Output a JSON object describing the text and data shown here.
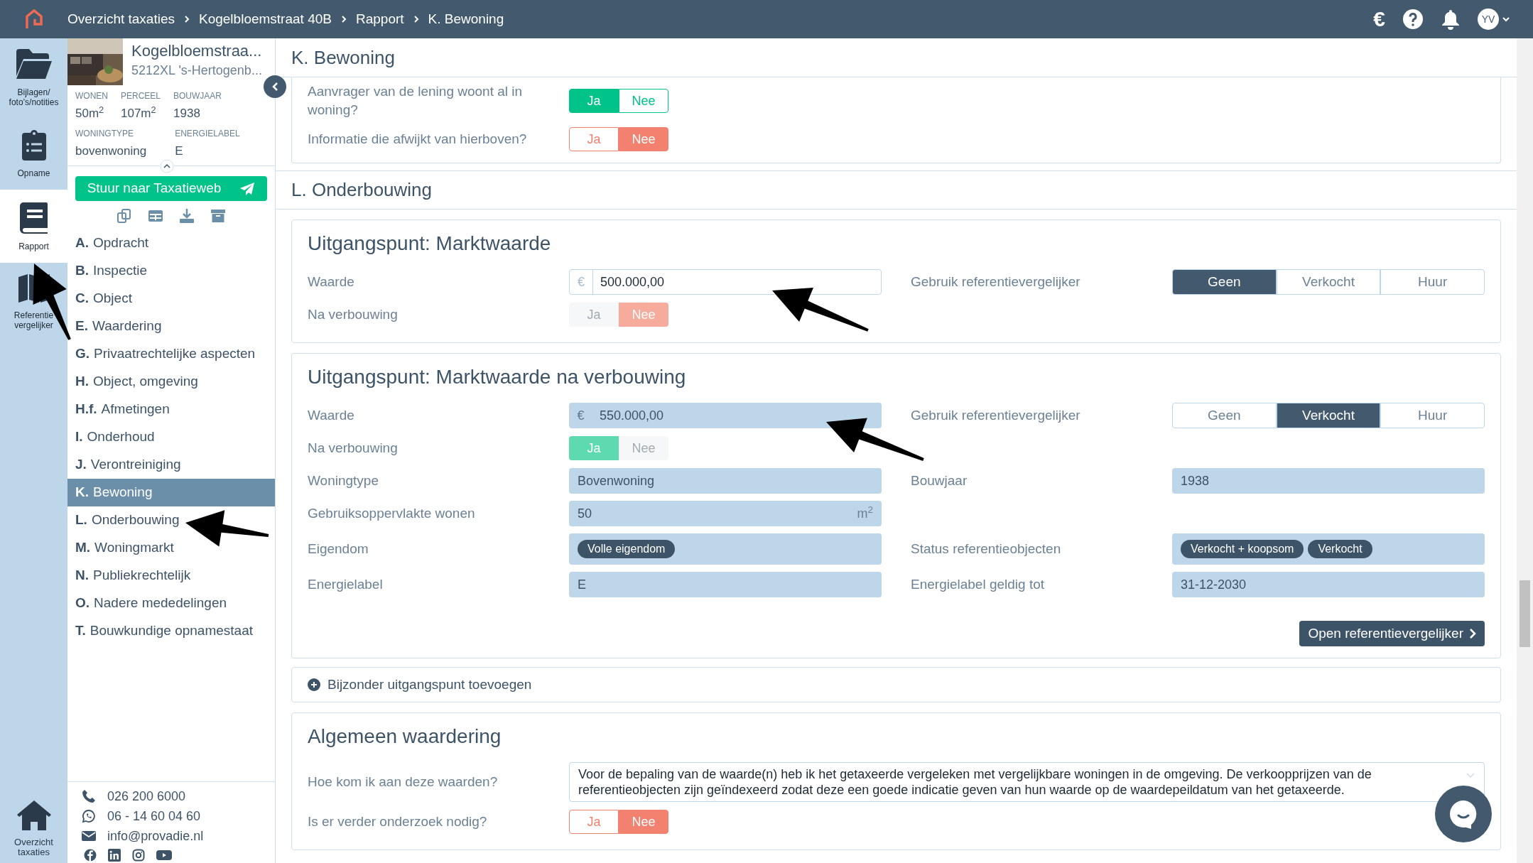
{
  "topbar": {
    "breadcrumbs": [
      "Overzicht taxaties",
      "Kogelbloemstraat 40B",
      "Rapport",
      "K. Bewoning"
    ],
    "currency_symbol": "€",
    "avatar": "YV"
  },
  "rail": [
    {
      "label": "Bijlagen/ foto’s/notities",
      "selected": false
    },
    {
      "label": "Opname",
      "selected": false
    },
    {
      "label": "Rapport",
      "selected": true
    },
    {
      "label": "Referentie vergelijker",
      "selected": false
    }
  ],
  "rail_bottom": {
    "label": "Overzicht taxaties"
  },
  "property": {
    "title": "Kogelbloemstraa...",
    "address": "5212XL 's-Hertogenb...",
    "facts": [
      {
        "label": "WONEN",
        "value": "50m$^{2}$"
      },
      {
        "label": "PERCEEL",
        "value": "107m$^{2}$"
      },
      {
        "label": "BOUWJAAR",
        "value": "1938"
      }
    ],
    "facts2": [
      {
        "label": "WONINGTYPE",
        "value": "bovenwoning"
      },
      {
        "label": "ENERGIELABEL",
        "value": "E"
      }
    ]
  },
  "send_button": "Stuur naar Taxatieweb",
  "nav": [
    {
      "letter": "A.",
      "label": "Opdracht",
      "selected": false
    },
    {
      "letter": "B.",
      "label": "Inspectie",
      "selected": false
    },
    {
      "letter": "C.",
      "label": "Object",
      "selected": false
    },
    {
      "letter": "E.",
      "label": "Waardering",
      "selected": false
    },
    {
      "letter": "G.",
      "label": "Privaatrechtelijke aspecten",
      "selected": false
    },
    {
      "letter": "H.",
      "label": "Object, omgeving",
      "selected": false
    },
    {
      "letter": "H.f.",
      "label": "Afmetingen",
      "selected": false
    },
    {
      "letter": "I.",
      "label": "Onderhoud",
      "selected": false
    },
    {
      "letter": "J.",
      "label": "Verontreiniging",
      "selected": false
    },
    {
      "letter": "K.",
      "label": "Bewoning",
      "selected": true
    },
    {
      "letter": "L.",
      "label": "Onderbouwing",
      "selected": false
    },
    {
      "letter": "M.",
      "label": "Woningmarkt",
      "selected": false
    },
    {
      "letter": "N.",
      "label": "Publiekrechtelijk",
      "selected": false
    },
    {
      "letter": "O.",
      "label": "Nadere mededelingen",
      "selected": false
    },
    {
      "letter": "T.",
      "label": "Bouwkundige opnamestaat",
      "selected": false
    }
  ],
  "contact": [
    {
      "kind": "phone",
      "text": "026 200 6000"
    },
    {
      "kind": "whatsapp",
      "text": "06 - 14 60 04 60"
    },
    {
      "kind": "mail",
      "text": "info@provadie.nl"
    }
  ],
  "sections": [
    {
      "heading": "K. Bewoning",
      "cards": [
        {
          "rows": [
            [
              {
                "kind": "toggle",
                "label": "Aanvrager van de lening woont al in woning?",
                "disabled": false,
                "options": [
                  {
                    "label": "Ja",
                    "selected": true
                  },
                  {
                    "label": "Nee",
                    "selected": false
                  }
                ]
              }
            ],
            [
              {
                "kind": "toggle",
                "label": "Informatie die afwijkt van hierboven?",
                "disabled": false,
                "options": [
                  {
                    "label": "Ja",
                    "selected": false
                  },
                  {
                    "label": "Nee",
                    "selected": true
                  }
                ]
              }
            ]
          ]
        }
      ]
    },
    {
      "heading": "L. Onderbouwing",
      "cards": [
        {
          "title": "Uitgangspunt: Marktwaarde",
          "rows": [
            [
              {
                "kind": "money",
                "label": "Waarde",
                "currency": "€",
                "value": "500.000,00",
                "readonly": false
              },
              {
                "kind": "segmented",
                "label": "Gebruik referentievergelijker",
                "options": [
                  {
                    "label": "Geen",
                    "selected": true
                  },
                  {
                    "label": "Verkocht",
                    "selected": false
                  },
                  {
                    "label": "Huur",
                    "selected": false
                  }
                ]
              }
            ],
            [
              {
                "kind": "toggle",
                "label": "Na verbouwing",
                "disabled": true,
                "options": [
                  {
                    "label": "Ja",
                    "selected": false
                  },
                  {
                    "label": "Nee",
                    "selected": true
                  }
                ]
              }
            ]
          ]
        },
        {
          "title": "Uitgangspunt: Marktwaarde na verbouwing",
          "rows": [
            [
              {
                "kind": "money",
                "label": "Waarde",
                "currency": "€",
                "value": "550.000,00",
                "readonly": true
              },
              {
                "kind": "segmented",
                "label": "Gebruik referentievergelijker",
                "options": [
                  {
                    "label": "Geen",
                    "selected": false
                  },
                  {
                    "label": "Verkocht",
                    "selected": true
                  },
                  {
                    "label": "Huur",
                    "selected": false
                  }
                ]
              }
            ],
            [
              {
                "kind": "toggle",
                "label": "Na verbouwing",
                "disabled": true,
                "options": [
                  {
                    "label": "Ja",
                    "selected": true
                  },
                  {
                    "label": "Nee",
                    "selected": false
                  }
                ]
              }
            ],
            [
              {
                "kind": "text",
                "label": "Woningtype",
                "value": "Bovenwoning"
              },
              {
                "kind": "text",
                "label": "Bouwjaar",
                "value": "1938"
              }
            ],
            [
              {
                "kind": "text",
                "label": "Gebruiksoppervlakte wonen",
                "value": "50",
                "unit": "m$^{2}$"
              }
            ],
            [
              {
                "kind": "tags",
                "label": "Eigendom",
                "tags": [
                  "Volle eigendom"
                ]
              },
              {
                "kind": "tags",
                "label": "Status referentieobjecten",
                "tags": [
                  "Verkocht + koopsom",
                  "Verkocht"
                ]
              }
            ],
            [
              {
                "kind": "text",
                "label": "Energielabel",
                "value": "E"
              },
              {
                "kind": "text",
                "label": "Energielabel geldig tot",
                "value": "31-12-2030"
              }
            ]
          ],
          "button": "Open referentievergelijker"
        },
        {
          "add_link": "Bijzonder uitgangspunt toevoegen"
        },
        {
          "title": "Algemeen waardering",
          "rows": [
            [
              {
                "kind": "textarea",
                "label": "Hoe kom ik aan deze waarden?",
                "value": "Voor de bepaling van de waarde(n) heb ik het getaxeerde vergeleken met vergelijkbare woningen in de omgeving. De verkoopprijzen van de referentieobjecten zijn geïndexeerd zodat deze een goede indicatie geven van hun waarde op de waardepeildatum van het getaxeerde."
              }
            ],
            [
              {
                "kind": "toggle",
                "label": "Is er verder onderzoek nodig?",
                "disabled": false,
                "options": [
                  {
                    "label": "Ja",
                    "selected": false
                  },
                  {
                    "label": "Nee",
                    "selected": true
                  }
                ]
              }
            ]
          ]
        }
      ]
    }
  ]
}
